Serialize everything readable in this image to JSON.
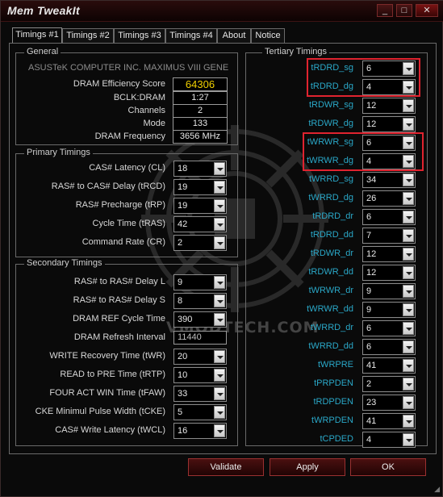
{
  "window": {
    "title": "Mem TweakIt"
  },
  "tabs": [
    {
      "label": "Timings #1"
    },
    {
      "label": "Timings #2"
    },
    {
      "label": "Timings #3"
    },
    {
      "label": "Timings #4"
    },
    {
      "label": "About"
    },
    {
      "label": "Notice"
    }
  ],
  "general": {
    "title": "General",
    "board": "ASUSTeK COMPUTER INC. MAXIMUS VIII GENE",
    "rows": [
      {
        "label": "DRAM Efficiency Score",
        "value": "64306",
        "highlight": true
      },
      {
        "label": "BCLK:DRAM",
        "value": "1:27"
      },
      {
        "label": "Channels",
        "value": "2"
      },
      {
        "label": "Mode",
        "value": "133"
      },
      {
        "label": "DRAM Frequency",
        "value": "3656 MHz"
      }
    ]
  },
  "primary": {
    "title": "Primary Timings",
    "rows": [
      {
        "label": "CAS# Latency (CL)",
        "value": "18"
      },
      {
        "label": "RAS# to CAS# Delay (tRCD)",
        "value": "19"
      },
      {
        "label": "RAS# Precharge (tRP)",
        "value": "19"
      },
      {
        "label": "Cycle Time (tRAS)",
        "value": "42"
      },
      {
        "label": "Command Rate (CR)",
        "value": "2"
      }
    ]
  },
  "secondary": {
    "title": "Secondary Timings",
    "rows": [
      {
        "label": "RAS# to RAS# Delay L",
        "value": "9",
        "combo": true
      },
      {
        "label": "RAS# to RAS# Delay S",
        "value": "8",
        "combo": true
      },
      {
        "label": "DRAM REF Cycle Time",
        "value": "390",
        "combo": true
      },
      {
        "label": "DRAM Refresh Interval",
        "value": "11440",
        "combo": false
      },
      {
        "label": "WRITE Recovery Time (tWR)",
        "value": "20",
        "combo": true
      },
      {
        "label": "READ to PRE Time (tRTP)",
        "value": "10",
        "combo": true
      },
      {
        "label": "FOUR ACT WIN Time (tFAW)",
        "value": "33",
        "combo": true
      },
      {
        "label": "CKE Minimul Pulse Width (tCKE)",
        "value": "5",
        "combo": true
      },
      {
        "label": "CAS# Write Latency (tWCL)",
        "value": "16",
        "combo": true
      }
    ]
  },
  "tertiary": {
    "title": "Tertiary Timings",
    "rows": [
      {
        "label": "tRDRD_sg",
        "value": "6"
      },
      {
        "label": "tRDRD_dg",
        "value": "4"
      },
      {
        "label": "tRDWR_sg",
        "value": "12"
      },
      {
        "label": "tRDWR_dg",
        "value": "12"
      },
      {
        "label": "tWRWR_sg",
        "value": "6"
      },
      {
        "label": "tWRWR_dg",
        "value": "4"
      },
      {
        "label": "tWRRD_sg",
        "value": "34"
      },
      {
        "label": "tWRRD_dg",
        "value": "26"
      },
      {
        "label": "tRDRD_dr",
        "value": "6"
      },
      {
        "label": "tRDRD_dd",
        "value": "7"
      },
      {
        "label": "tRDWR_dr",
        "value": "12"
      },
      {
        "label": "tRDWR_dd",
        "value": "12"
      },
      {
        "label": "tWRWR_dr",
        "value": "9"
      },
      {
        "label": "tWRWR_dd",
        "value": "9"
      },
      {
        "label": "tWRRD_dr",
        "value": "6"
      },
      {
        "label": "tWRRD_dd",
        "value": "6"
      },
      {
        "label": "tWRPRE",
        "value": "41"
      },
      {
        "label": "tPRPDEN",
        "value": "2"
      },
      {
        "label": "tRDPDEN",
        "value": "23"
      },
      {
        "label": "tWRPDEN",
        "value": "41"
      },
      {
        "label": "tCPDED",
        "value": "4"
      }
    ]
  },
  "buttons": {
    "validate": "Validate",
    "apply": "Apply",
    "ok": "OK"
  },
  "titlebar_buttons": {
    "minimize": "_",
    "maximize": "□",
    "close": "✕"
  },
  "watermark": "VMODTECH.COM",
  "colors": {
    "accent": "#e0232f",
    "tertiary_label": "#2aa8c8",
    "score": "#f0d000"
  }
}
